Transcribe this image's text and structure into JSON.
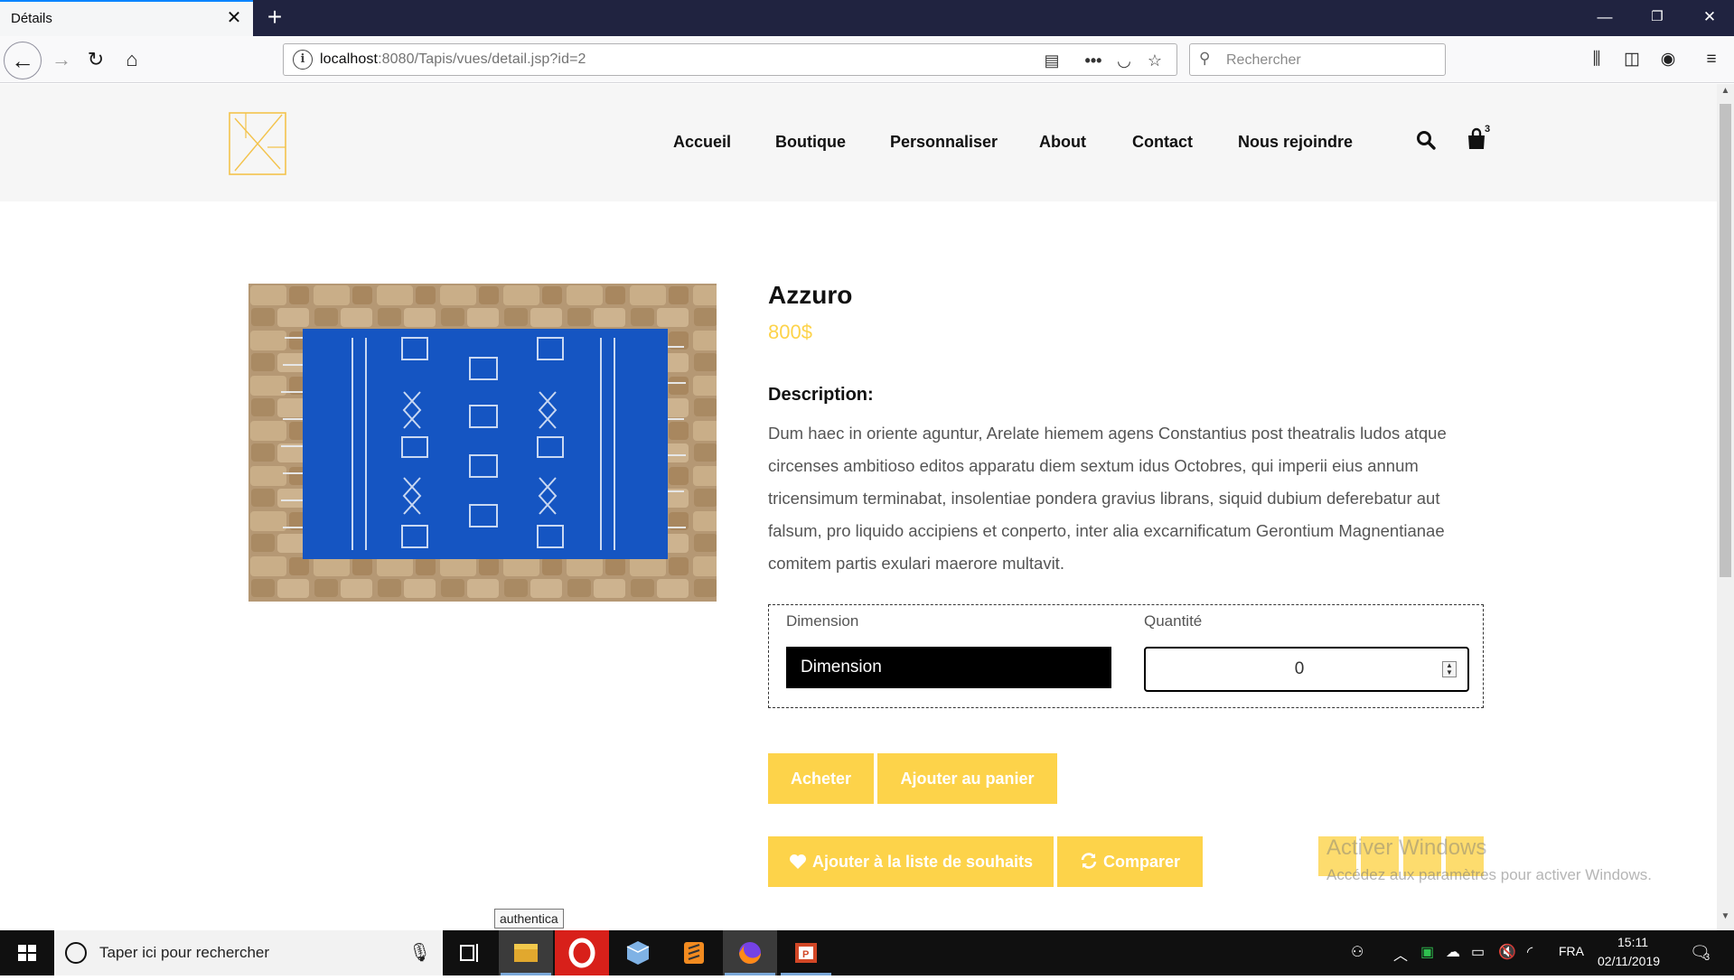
{
  "browser": {
    "tab_title": "Détails",
    "url_host": "localhost",
    "url_rest": ":8080/Tapis/vues/detail.jsp?id=2",
    "search_placeholder": "Rechercher"
  },
  "site": {
    "menu": [
      "Accueil",
      "Boutique",
      "Personnaliser",
      "About",
      "Contact",
      "Nous rejoindre"
    ],
    "cart_count": "3",
    "accent_color": "#fdd34a"
  },
  "product": {
    "name": "Azzuro",
    "price": "800$",
    "description_heading": "Description:",
    "description": "Dum haec in oriente aguntur, Arelate hiemem agens Constantius post theatralis ludos atque circenses ambitioso editos apparatu diem sextum idus Octobres, qui imperii eius annum tricensimum terminabat, insolentiae pondera gravius librans, siquid dubium deferebatur aut falsum, pro liquido accipiens et conperto, inter alia excarnificatum Gerontium Magnentianae comitem partis exulari maerore multavit.",
    "dimension_label": "Dimension",
    "dimension_selected": "Dimension",
    "quantity_label": "Quantité",
    "quantity_value": "0"
  },
  "buttons": {
    "buy": "Acheter",
    "add_to_cart": "Ajouter au panier",
    "wishlist": "Ajouter à la liste de souhaits",
    "compare": "Comparer"
  },
  "watermark": {
    "line1": "Activer Windows",
    "line2": "Accédez aux paramètres pour activer Windows."
  },
  "tooltip": "authentica",
  "taskbar": {
    "search_placeholder": "Taper ici pour rechercher",
    "language": "FRA",
    "time": "15:11",
    "date": "02/11/2019",
    "notifications": "3"
  }
}
